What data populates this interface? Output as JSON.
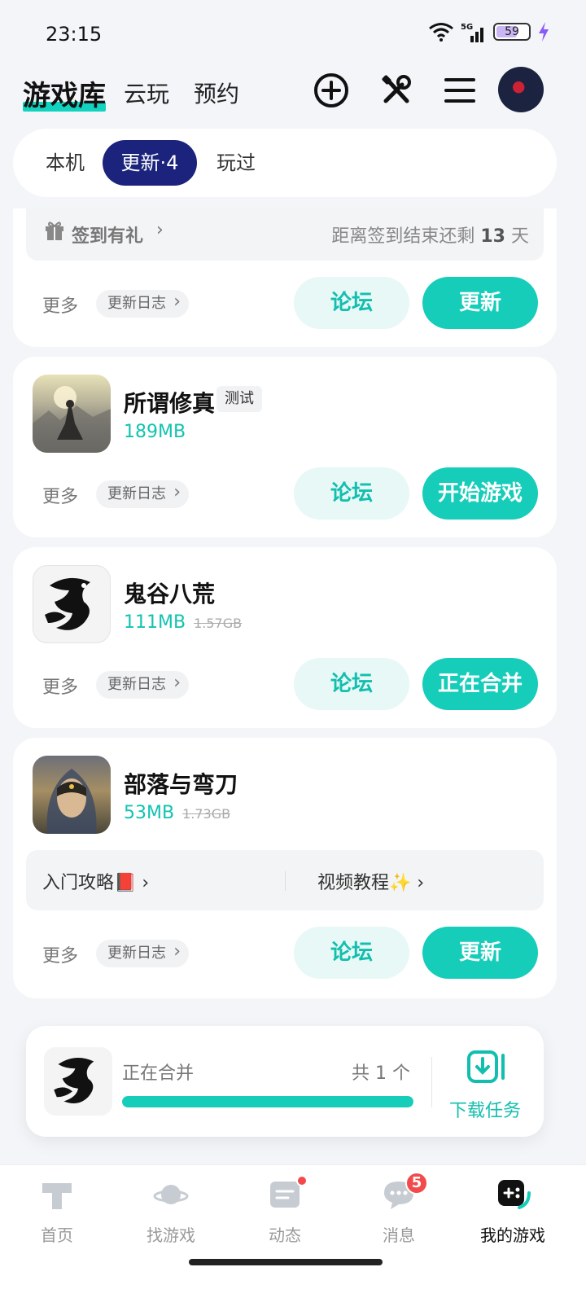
{
  "status_bar": {
    "time": "23:15",
    "network": "5G",
    "battery": "59"
  },
  "header": {
    "active_tab": "游戏库",
    "tabs": [
      "云玩",
      "预约"
    ],
    "icons": [
      "add-circle-icon",
      "tools-icon",
      "menu-icon"
    ]
  },
  "filter_tabs": [
    "本机",
    "更新·4",
    "玩过"
  ],
  "checkin": {
    "label": "签到有礼",
    "text_prefix": "距离签到结束还剩",
    "days": "13",
    "unit": "天"
  },
  "common": {
    "more": "更多",
    "changelog": "更新日志",
    "forum": "论坛"
  },
  "games": [
    {
      "action": "更新"
    },
    {
      "title": "所谓修真",
      "tag": "测试",
      "size": "189MB",
      "action": "开始游戏"
    },
    {
      "title": "鬼谷八荒",
      "size": "111MB",
      "old_size": "1.57GB",
      "action": "正在合并"
    },
    {
      "title": "部落与弯刀",
      "size": "53MB",
      "old_size": "1.73GB",
      "guide_left": "入门攻略📕 ›",
      "guide_right": "视频教程✨ ›",
      "action": "更新"
    }
  ],
  "download_task": {
    "status": "正在合并",
    "count": "共 1 个",
    "progress": 1.0,
    "label": "下载任务"
  },
  "bottom_nav": {
    "items": [
      "首页",
      "找游戏",
      "动态",
      "消息",
      "我的游戏"
    ],
    "active": "我的游戏",
    "message_badge": "5"
  },
  "colors": {
    "accent": "#15cdb9",
    "filter_active": "#1b237d",
    "badge": "#f24a4a"
  }
}
